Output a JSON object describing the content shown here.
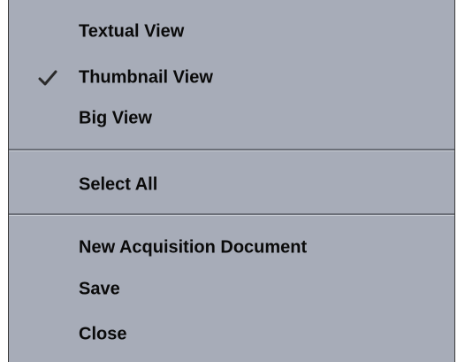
{
  "menu": {
    "items": [
      {
        "label": "Textual View"
      },
      {
        "label": "Thumbnail View",
        "checked": true,
        "check_icon": "checkmark-icon"
      },
      {
        "label": "Big View"
      },
      {
        "label": "Select All"
      },
      {
        "label": "New Acquisition Document"
      },
      {
        "label": "Save"
      },
      {
        "label": "Close"
      }
    ]
  },
  "colors": {
    "menu_background": "#a7acb8",
    "separator": "#6b6f78",
    "text": "#0a0a0a"
  }
}
